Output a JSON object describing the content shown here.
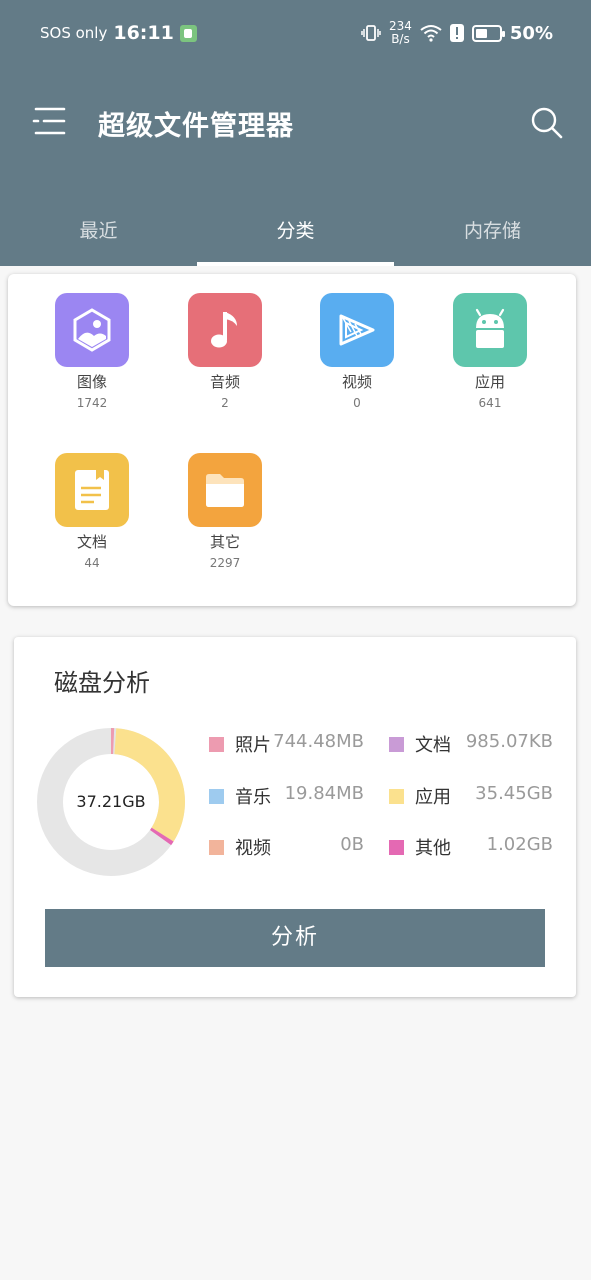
{
  "status_bar": {
    "carrier": "SOS only",
    "time": "16:11",
    "net_speed_value": "234",
    "net_speed_unit": "B/s",
    "battery": "50%",
    "battery_level": 0.5
  },
  "header": {
    "title": "超级文件管理器",
    "tabs": [
      {
        "label": "最近",
        "active": false
      },
      {
        "label": "分类",
        "active": true
      },
      {
        "label": "内存储",
        "active": false
      }
    ]
  },
  "categories": [
    {
      "name": "图像",
      "count": "1742",
      "icon": "image-icon",
      "color": "#9b86f2"
    },
    {
      "name": "音频",
      "count": "2",
      "icon": "music-icon",
      "color": "#e66f78"
    },
    {
      "name": "视频",
      "count": "0",
      "icon": "video-icon",
      "color": "#59adf0"
    },
    {
      "name": "应用",
      "count": "641",
      "icon": "android-icon",
      "color": "#5ec6ac"
    },
    {
      "name": "文档",
      "count": "44",
      "icon": "document-icon",
      "color": "#f2c14a"
    },
    {
      "name": "其它",
      "count": "2297",
      "icon": "folder-icon",
      "color": "#f3a43e"
    }
  ],
  "disk_analysis": {
    "title": "磁盘分析",
    "total": "37.21GB",
    "button_label": "分析",
    "legend": [
      {
        "label": "照片",
        "value": "744.48MB",
        "color": "#ed9bb0"
      },
      {
        "label": "文档",
        "value": "985.07KB",
        "color": "#c99bd6"
      },
      {
        "label": "音乐",
        "value": "19.84MB",
        "color": "#9ecbef"
      },
      {
        "label": "应用",
        "value": "35.45GB",
        "color": "#fbe18e"
      },
      {
        "label": "视频",
        "value": "0B",
        "color": "#f2b49b"
      },
      {
        "label": "其他",
        "value": "1.02GB",
        "color": "#e469b3"
      }
    ],
    "chart_data": {
      "type": "pie",
      "categories": [
        "照片",
        "文档",
        "音乐",
        "应用",
        "视频",
        "其他"
      ],
      "values_gb": [
        0.744,
        0.001,
        0.019,
        35.45,
        0,
        1.02
      ],
      "track_color": "#e6e6e6"
    }
  }
}
